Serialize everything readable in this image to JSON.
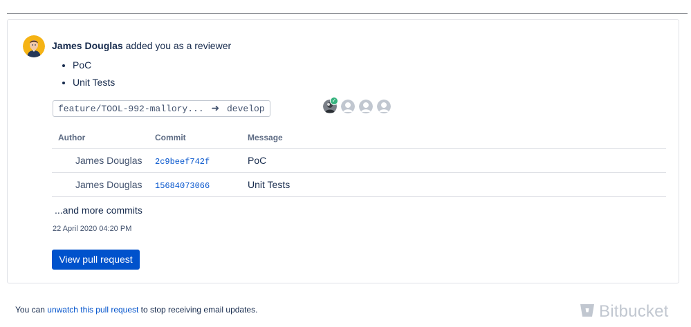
{
  "notification": {
    "actor": "James Douglas",
    "action": "added you as a reviewer",
    "items": [
      "PoC",
      "Unit Tests"
    ]
  },
  "branch": {
    "source": "feature/TOOL-992-mallory...",
    "arrow": "➜",
    "target": "develop"
  },
  "reviewers": {
    "approved_badge": "✓",
    "count": 4,
    "approved_count": 1
  },
  "commits": {
    "headers": {
      "author": "Author",
      "commit": "Commit",
      "message": "Message"
    },
    "rows": [
      {
        "author": "James Douglas",
        "hash": "2c9beef742f",
        "message": "PoC"
      },
      {
        "author": "James Douglas",
        "hash": "15684073066",
        "message": "Unit Tests"
      }
    ],
    "more_label": "...and more commits"
  },
  "date": "22 April 2020 04:20 PM",
  "view_button_label": "View pull request",
  "footer": {
    "prefix": "You can ",
    "link": "unwatch this pull request",
    "suffix": " to stop receiving email updates."
  },
  "brand": {
    "name": "Bitbucket",
    "icon": "bitbucket-logo-icon"
  },
  "colors": {
    "link": "#0052CC",
    "button": "#0052CC",
    "approved": "#36B37E",
    "text": "#172B4D",
    "muted": "#5E6C84"
  }
}
